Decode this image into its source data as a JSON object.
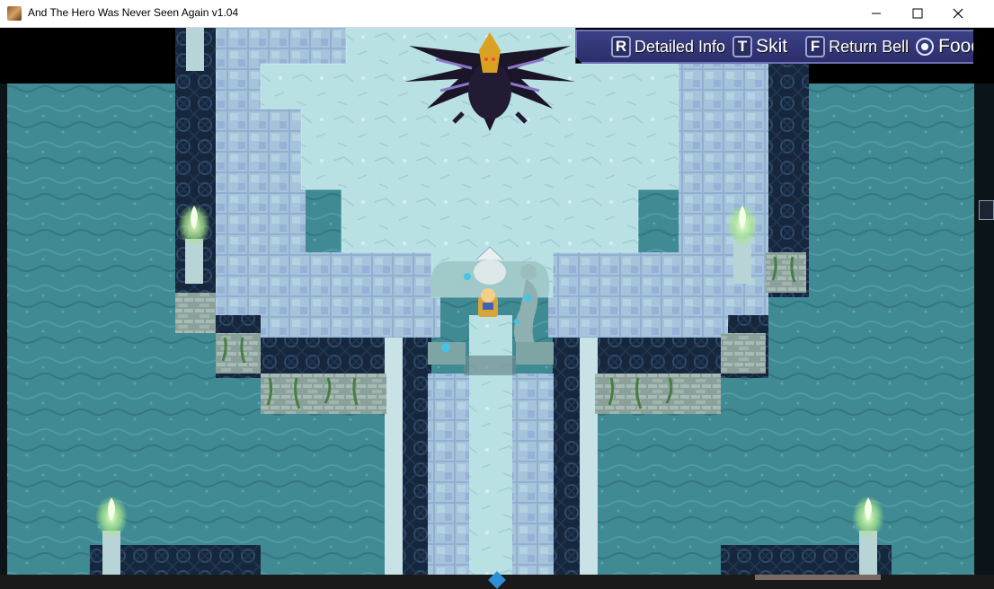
{
  "window": {
    "title": "And The Hero Was Never Seen Again v1.04"
  },
  "hud": {
    "items": [
      {
        "key": "R",
        "label": "Detailed Info"
      },
      {
        "key": "T",
        "label": "Skit"
      },
      {
        "key": "F",
        "label": "Return Bell"
      },
      {
        "key": "",
        "label": "Food"
      }
    ]
  },
  "colors": {
    "water": "#3f8a93",
    "floor": "#b9e1e4",
    "tile": "#8fb0cf",
    "dark_wall": "#16273d",
    "hud_bg": "#34377a"
  },
  "icons": [
    "app-icon",
    "minimize-icon",
    "maximize-icon",
    "close-icon",
    "dark-dragon-boss",
    "player-character",
    "flame-torch",
    "mermaid-statue"
  ]
}
